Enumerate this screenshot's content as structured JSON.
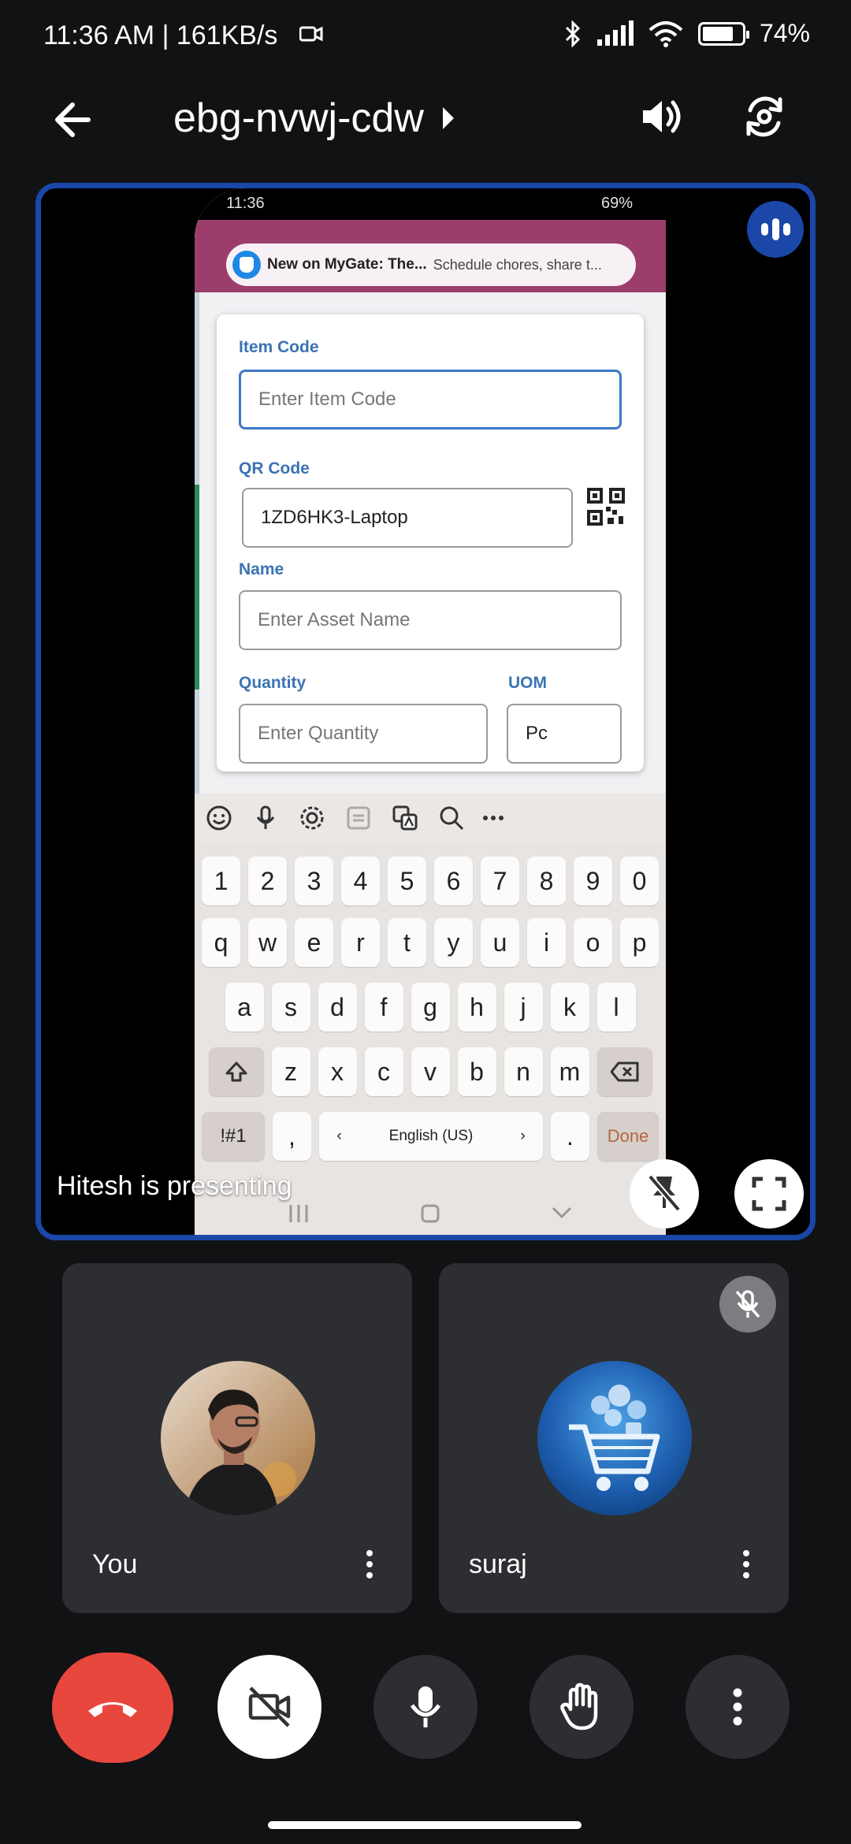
{
  "status_bar": {
    "time": "11:36 AM | 161KB/s",
    "battery": "74%"
  },
  "meeting": {
    "code": "ebg-nvwj-cdw"
  },
  "presentation": {
    "label": "Hitesh is presenting",
    "shared_screen": {
      "time": "11:36",
      "battery": "69%",
      "notification": {
        "title": "New on MyGate: The...",
        "text": "Schedule chores, share t..."
      },
      "form": {
        "item_code_label": "Item Code",
        "item_code_placeholder": "Enter Item Code",
        "qr_code_label": "QR Code",
        "qr_code_value": "1ZD6HK3-Laptop",
        "name_label": "Name",
        "name_placeholder": "Enter Asset Name",
        "quantity_label": "Quantity",
        "quantity_placeholder": "Enter Quantity",
        "uom_label": "UOM",
        "uom_value": "Pc"
      },
      "keyboard": {
        "numbers": [
          "1",
          "2",
          "3",
          "4",
          "5",
          "6",
          "7",
          "8",
          "9",
          "0"
        ],
        "row1": [
          "q",
          "w",
          "e",
          "r",
          "t",
          "y",
          "u",
          "i",
          "o",
          "p"
        ],
        "row2": [
          "a",
          "s",
          "d",
          "f",
          "g",
          "h",
          "j",
          "k",
          "l"
        ],
        "row3": [
          "z",
          "x",
          "c",
          "v",
          "b",
          "n",
          "m"
        ],
        "symbols_key": "!#1",
        "comma_key": ",",
        "language": "English (US)",
        "period_key": ".",
        "done_key": "Done"
      }
    }
  },
  "participants": [
    {
      "name": "You"
    },
    {
      "name": "suraj"
    }
  ],
  "colors": {
    "accent_border": "#1a47a8",
    "end_call": "#e8473d",
    "tile_bg": "#2d2e31"
  }
}
